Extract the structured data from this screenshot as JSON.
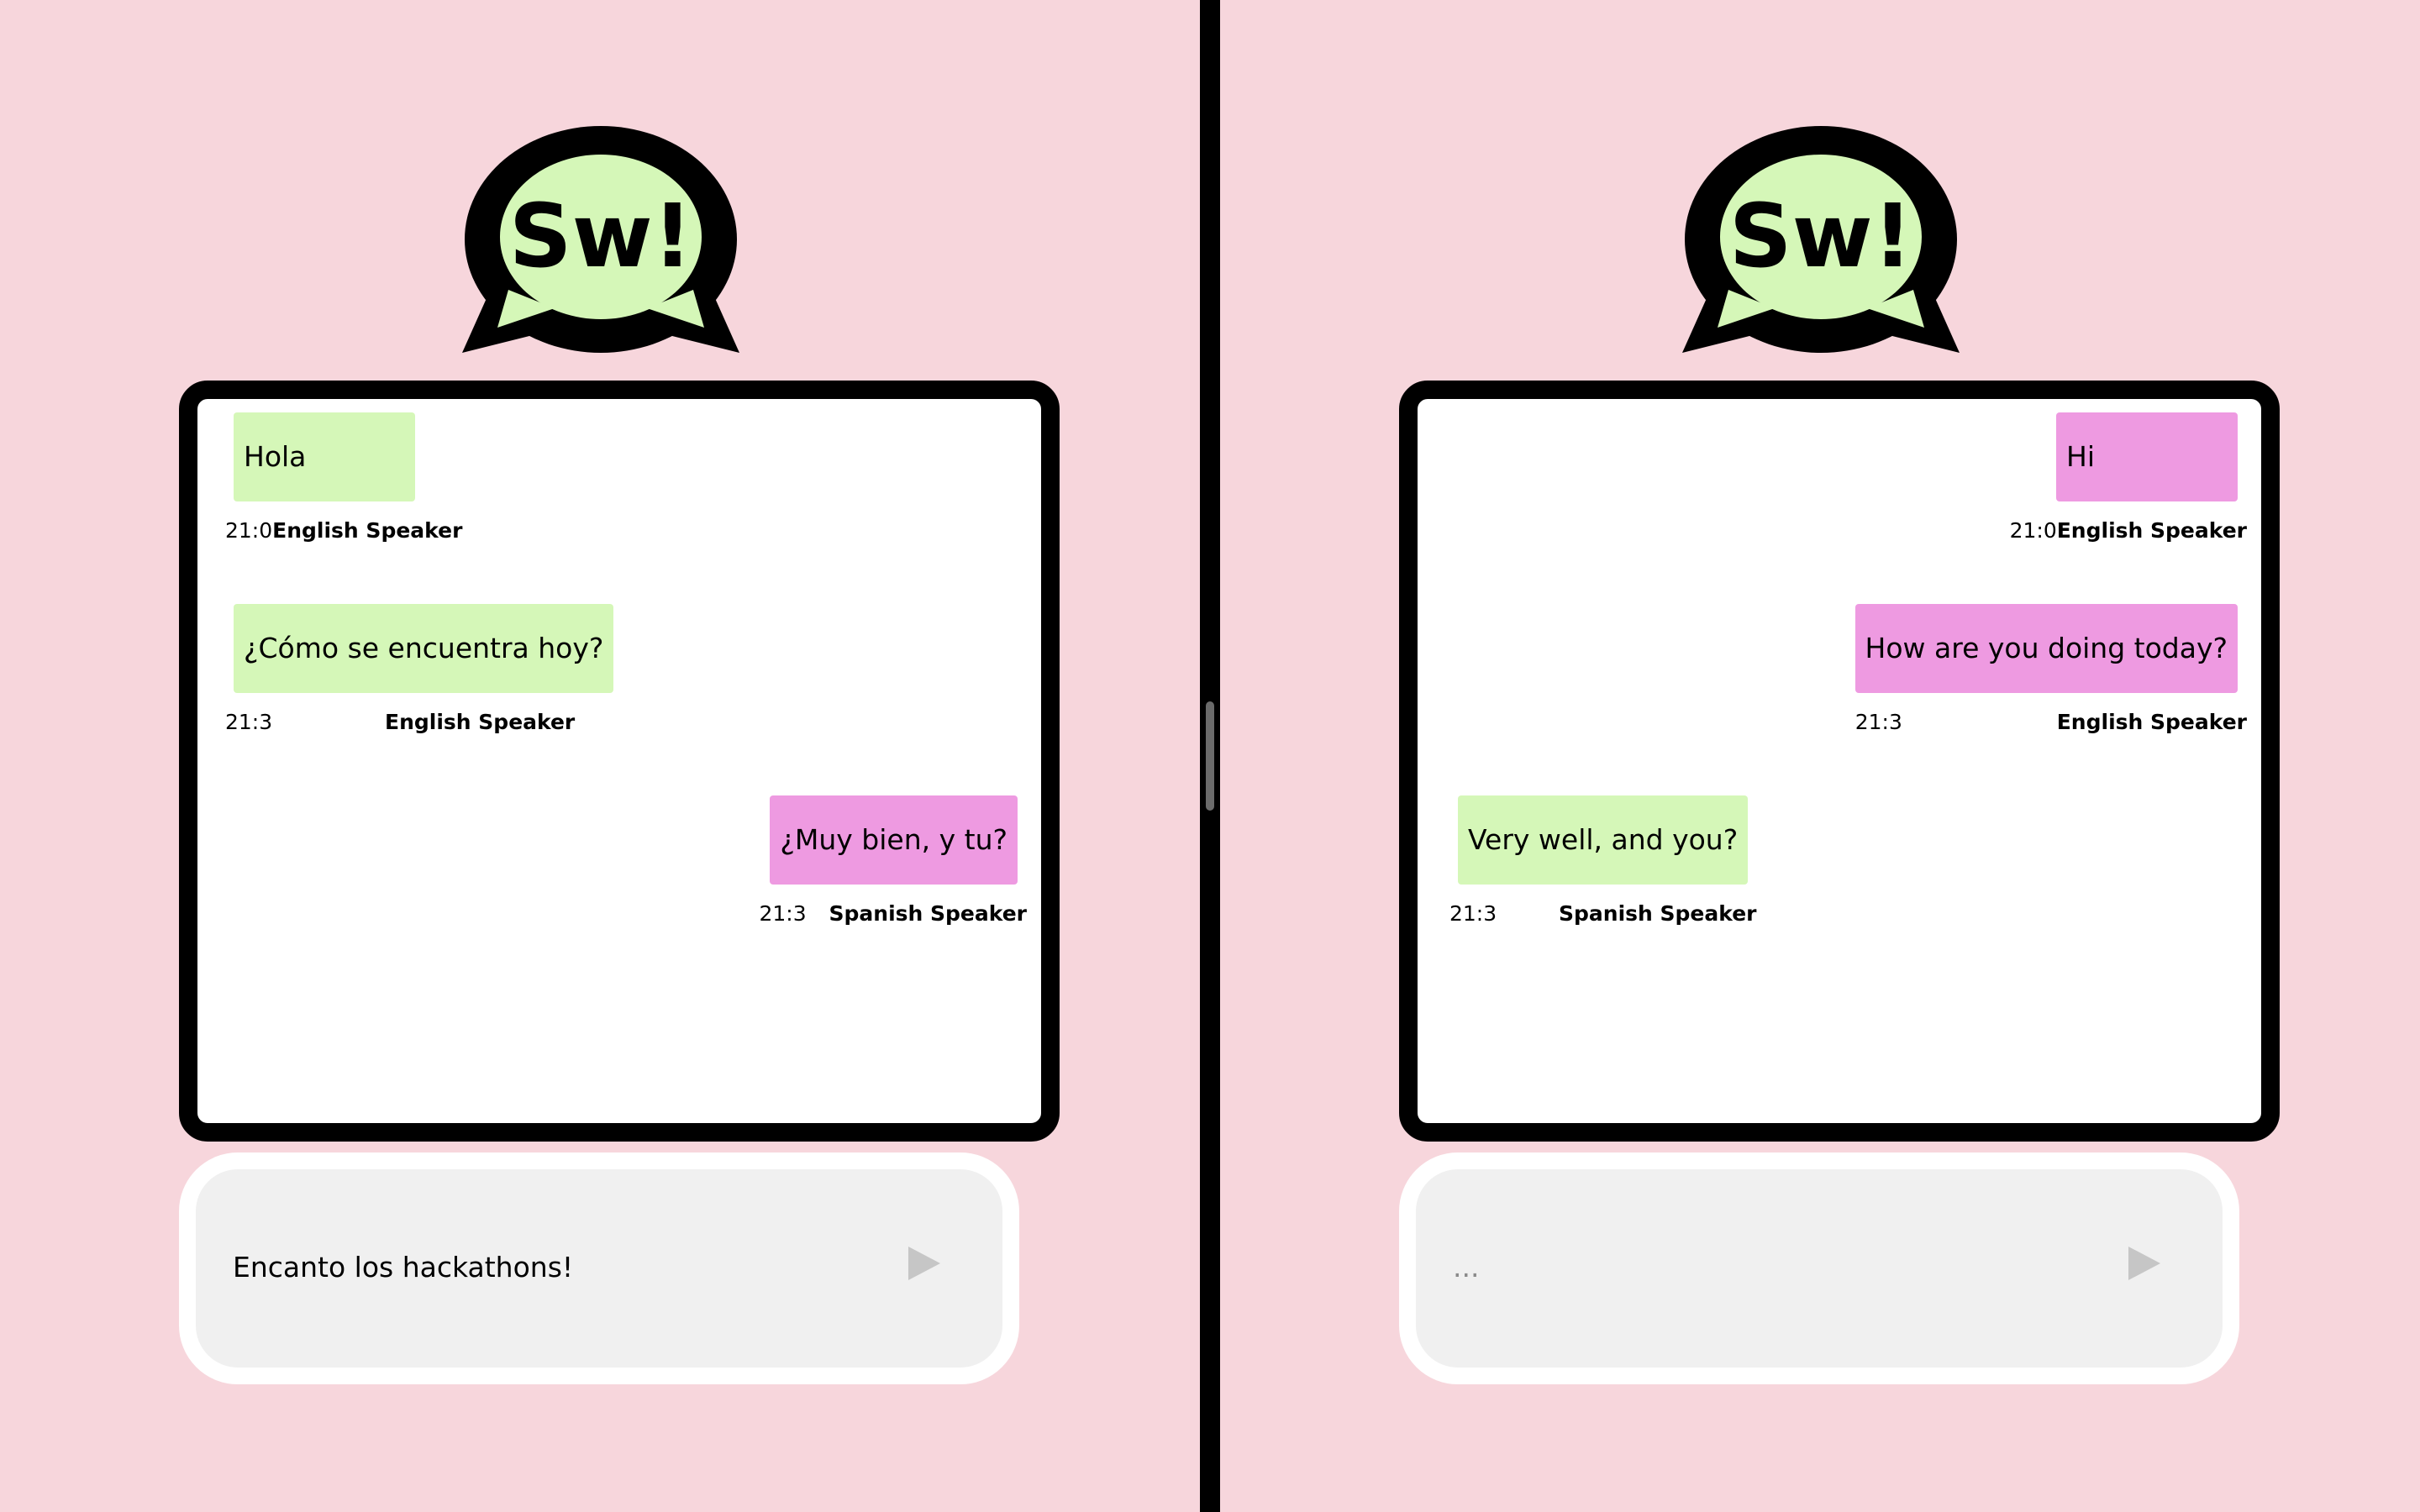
{
  "left": {
    "logo_text": "Sw!",
    "messages": [
      {
        "text": "Hola",
        "time": "21:0",
        "speaker": "English Speaker",
        "color": "green"
      },
      {
        "text": "¿Cómo se encuentra hoy?",
        "time": "21:3",
        "speaker": "English Speaker",
        "color": "green"
      },
      {
        "text": "¿Muy bien, y tu?",
        "time": "21:3",
        "speaker": "Spanish Speaker",
        "color": "pink"
      }
    ],
    "input": {
      "value": "Encanto los hackathons!",
      "placeholder": "..."
    }
  },
  "right": {
    "logo_text": "Sw!",
    "messages": [
      {
        "text": "Hi",
        "time": "21:0",
        "speaker": "English Speaker",
        "color": "pink"
      },
      {
        "text": "How are you doing today?",
        "time": "21:3",
        "speaker": "English Speaker",
        "color": "pink"
      },
      {
        "text": "Very well, and you?",
        "time": "21:3",
        "speaker": "Spanish Speaker",
        "color": "green"
      }
    ],
    "input": {
      "value": "",
      "placeholder": "..."
    }
  },
  "colors": {
    "background": "#f7d6dc",
    "bubble_green": "#d5f7b8",
    "bubble_pink": "#ee9ae1",
    "logo_green": "#d5f7b8"
  },
  "icons": {
    "send": "send-arrow-icon",
    "logo": "speech-bubble-logo"
  }
}
